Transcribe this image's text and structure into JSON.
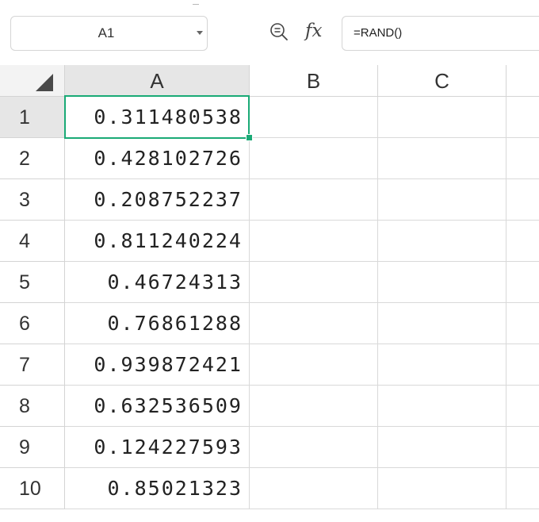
{
  "formula_bar": {
    "name_box": "A1",
    "fx_label": "fx",
    "formula": "=RAND()"
  },
  "columns": [
    "A",
    "B",
    "C"
  ],
  "rows": [
    {
      "num": "1",
      "a": "0.311480538"
    },
    {
      "num": "2",
      "a": "0.428102726"
    },
    {
      "num": "3",
      "a": "0.208752237"
    },
    {
      "num": "4",
      "a": "0.811240224"
    },
    {
      "num": "5",
      "a": "0.46724313"
    },
    {
      "num": "6",
      "a": "0.76861288"
    },
    {
      "num": "7",
      "a": "0.939872421"
    },
    {
      "num": "8",
      "a": "0.632536509"
    },
    {
      "num": "9",
      "a": "0.124227593"
    },
    {
      "num": "10",
      "a": "0.85021323"
    }
  ],
  "selected_cell": "A1",
  "icons": {
    "zoom": "zoom-icon",
    "function": "fx-icon",
    "dropdown": "chevron-down-icon",
    "select_all": "select-all-triangle-icon"
  },
  "colors": {
    "selection": "#1aaa76",
    "header_active": "#e6e6e6"
  }
}
